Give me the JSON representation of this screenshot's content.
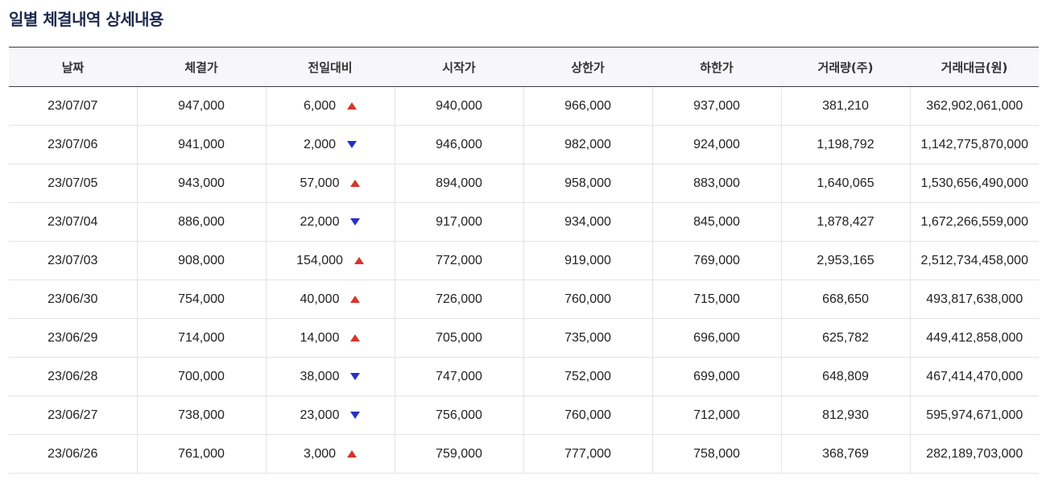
{
  "page": {
    "title": "일별 체결내역 상세내용"
  },
  "colors": {
    "title": "#1d2a4d",
    "up": "#d6352b",
    "down": "#2530c9"
  },
  "table": {
    "headers": [
      "날짜",
      "체결가",
      "전일대비",
      "시작가",
      "상한가",
      "하한가",
      "거래량(주)",
      "거래대금(원)"
    ],
    "rows": [
      {
        "date": "23/07/07",
        "close": "947,000",
        "change": "6,000",
        "direction": "up",
        "open": "940,000",
        "high": "966,000",
        "low": "937,000",
        "volume": "381,210",
        "amount": "362,902,061,000"
      },
      {
        "date": "23/07/06",
        "close": "941,000",
        "change": "2,000",
        "direction": "down",
        "open": "946,000",
        "high": "982,000",
        "low": "924,000",
        "volume": "1,198,792",
        "amount": "1,142,775,870,000"
      },
      {
        "date": "23/07/05",
        "close": "943,000",
        "change": "57,000",
        "direction": "up",
        "open": "894,000",
        "high": "958,000",
        "low": "883,000",
        "volume": "1,640,065",
        "amount": "1,530,656,490,000"
      },
      {
        "date": "23/07/04",
        "close": "886,000",
        "change": "22,000",
        "direction": "down",
        "open": "917,000",
        "high": "934,000",
        "low": "845,000",
        "volume": "1,878,427",
        "amount": "1,672,266,559,000"
      },
      {
        "date": "23/07/03",
        "close": "908,000",
        "change": "154,000",
        "direction": "up",
        "open": "772,000",
        "high": "919,000",
        "low": "769,000",
        "volume": "2,953,165",
        "amount": "2,512,734,458,000"
      },
      {
        "date": "23/06/30",
        "close": "754,000",
        "change": "40,000",
        "direction": "up",
        "open": "726,000",
        "high": "760,000",
        "low": "715,000",
        "volume": "668,650",
        "amount": "493,817,638,000"
      },
      {
        "date": "23/06/29",
        "close": "714,000",
        "change": "14,000",
        "direction": "up",
        "open": "705,000",
        "high": "735,000",
        "low": "696,000",
        "volume": "625,782",
        "amount": "449,412,858,000"
      },
      {
        "date": "23/06/28",
        "close": "700,000",
        "change": "38,000",
        "direction": "down",
        "open": "747,000",
        "high": "752,000",
        "low": "699,000",
        "volume": "648,809",
        "amount": "467,414,470,000"
      },
      {
        "date": "23/06/27",
        "close": "738,000",
        "change": "23,000",
        "direction": "down",
        "open": "756,000",
        "high": "760,000",
        "low": "712,000",
        "volume": "812,930",
        "amount": "595,974,671,000"
      },
      {
        "date": "23/06/26",
        "close": "761,000",
        "change": "3,000",
        "direction": "up",
        "open": "759,000",
        "high": "777,000",
        "low": "758,000",
        "volume": "368,769",
        "amount": "282,189,703,000"
      }
    ]
  }
}
